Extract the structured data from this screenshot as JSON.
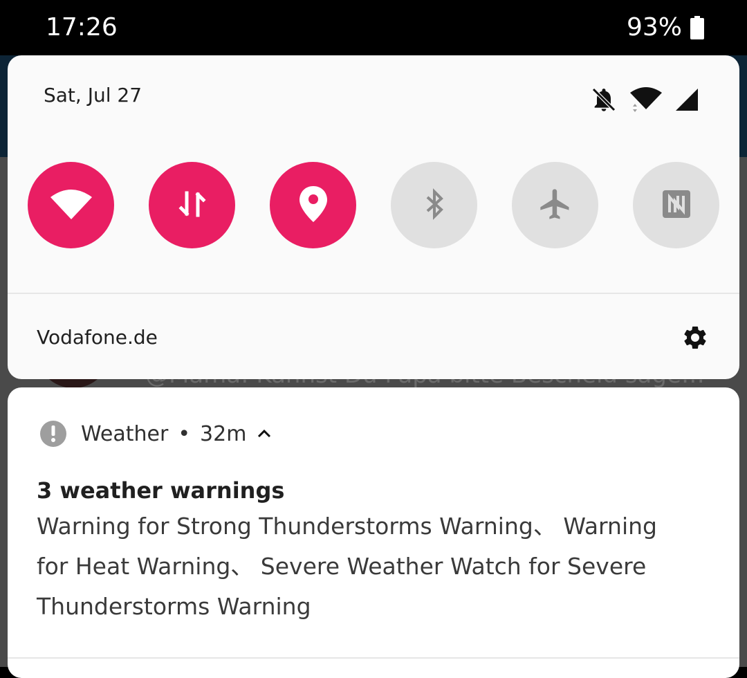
{
  "status_bar": {
    "time": "17:26",
    "battery_percent": "93%",
    "battery_level": 0.93
  },
  "background": {
    "peek_text": "@Mama: Kannst Du Papa bitte Bescheid sagen, ..."
  },
  "quick_settings": {
    "date": "Sat, Jul 27",
    "status_icons": [
      "bell-off-icon",
      "wifi-icon",
      "cell-signal-icon"
    ],
    "tiles": [
      {
        "icon": "wifi-icon",
        "active": true
      },
      {
        "icon": "mobile-data-icon",
        "active": true
      },
      {
        "icon": "location-icon",
        "active": true
      },
      {
        "icon": "bluetooth-icon",
        "active": false
      },
      {
        "icon": "airplane-icon",
        "active": false
      },
      {
        "icon": "nfc-icon",
        "active": false
      }
    ],
    "carrier": "Vodafone.de",
    "accent_color": "#e91e63",
    "inactive_color": "#e0e0e0"
  },
  "notification": {
    "app_icon": "alert-icon",
    "app_name": "Weather",
    "separator": "•",
    "time": "32m",
    "title": "3 weather warnings",
    "body": "Warning for Strong Thunderstorms Warning、 Warning for Heat Warning、 Severe Weather Watch for Severe Thunderstorms Warning"
  }
}
